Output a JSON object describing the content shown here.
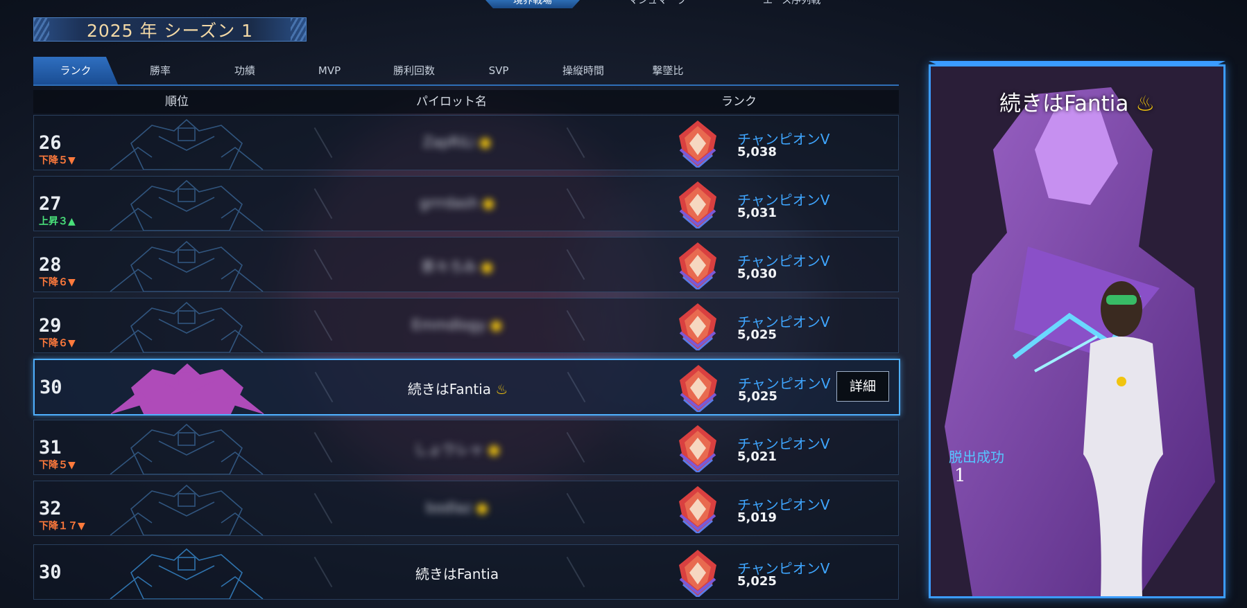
{
  "top_nav": {
    "tabs": [
      {
        "label": "境界戦場",
        "active": true
      },
      {
        "label": "マシュマーク",
        "active": false
      },
      {
        "label": "エース序列戦",
        "active": false
      }
    ]
  },
  "season": {
    "label": "2025 年  シーズン 1"
  },
  "tabs": [
    {
      "label": "ランク",
      "active": true
    },
    {
      "label": "勝率",
      "active": false
    },
    {
      "label": "功績",
      "active": false
    },
    {
      "label": "MVP",
      "active": false
    },
    {
      "label": "勝利回数",
      "active": false
    },
    {
      "label": "SVP",
      "active": false
    },
    {
      "label": "操縦時間",
      "active": false
    },
    {
      "label": "撃墜比",
      "active": false
    }
  ],
  "table_header": {
    "rank_col": "順位",
    "pilot_col": "パイロット名",
    "tier_col": "ランク"
  },
  "rows": [
    {
      "rank": "26",
      "change": "下降５▼",
      "change_dir": "down",
      "pilot": "ZapRiLi",
      "pilot_blurred": true,
      "pilot_badge": "●",
      "tier": "チャンピオンV",
      "points": "5,038",
      "mech_color": "#3e6fa3",
      "highlight": false
    },
    {
      "rank": "27",
      "change": "上昇３▲",
      "change_dir": "up",
      "pilot": "grrrdash",
      "pilot_blurred": true,
      "pilot_badge": "●",
      "tier": "チャンピオンV",
      "points": "5,031",
      "mech_color": "#3e6fa3",
      "highlight": false
    },
    {
      "rank": "28",
      "change": "下降６▼",
      "change_dir": "down",
      "pilot": "茶々ろみ",
      "pilot_blurred": true,
      "pilot_badge": "●",
      "tier": "チャンピオンV",
      "points": "5,030",
      "mech_color": "#3e6fa3",
      "highlight": false
    },
    {
      "rank": "29",
      "change": "下降６▼",
      "change_dir": "down",
      "pilot": "Emmdlogy",
      "pilot_blurred": true,
      "pilot_badge": "●",
      "tier": "チャンピオンV",
      "points": "5,025",
      "mech_color": "#3e6fa3",
      "highlight": false
    },
    {
      "rank": "30",
      "change": "",
      "change_dir": "none",
      "pilot": "続きはFantia",
      "pilot_blurred": false,
      "pilot_badge": "♨",
      "tier": "チャンピオンV",
      "points": "5,025",
      "mech_color": "#c050c8",
      "highlight": true,
      "detail": "詳細"
    },
    {
      "rank": "31",
      "change": "下降５▼",
      "change_dir": "down",
      "pilot": "しょウレャ",
      "pilot_blurred": true,
      "pilot_badge": "●",
      "tier": "チャンピオンV",
      "points": "5,021",
      "mech_color": "#3e6fa3",
      "highlight": false
    },
    {
      "rank": "32",
      "change": "下降１７▼",
      "change_dir": "down",
      "pilot": "bodlaz",
      "pilot_blurred": true,
      "pilot_badge": "●",
      "tier": "チャンピオンV",
      "points": "5,019",
      "mech_color": "#3e6fa3",
      "highlight": false
    },
    {
      "rank": "30",
      "change": "",
      "change_dir": "none",
      "pilot": "続きはFantia",
      "pilot_blurred": false,
      "pilot_badge": "",
      "tier": "チャンピオンV",
      "points": "5,025",
      "mech_color": "#3d9be8",
      "highlight": false
    }
  ],
  "profile_card": {
    "name": "続きはFantia",
    "badge": "♨",
    "stat_label": "脱出成功",
    "stat_value": "1"
  },
  "colors": {
    "accent": "#3b9cff",
    "down": "#ff7a3c",
    "up": "#49e07a",
    "tier_text": "#3fa6ff",
    "season_text": "#f3d9a6"
  }
}
